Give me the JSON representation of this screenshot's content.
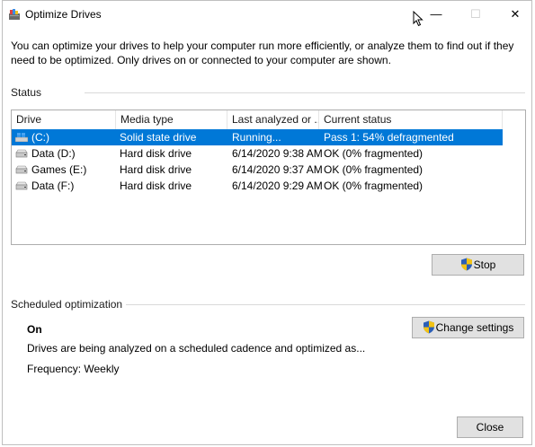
{
  "window": {
    "title": "Optimize Drives",
    "controls": {
      "minimize": "—",
      "maximize": "☐",
      "close": "✕"
    }
  },
  "description": "You can optimize your drives to help your computer run more efficiently, or analyze them to find out if they need to be optimized. Only drives on or connected to your computer are shown.",
  "status": {
    "label": "Status",
    "columns": [
      "Drive",
      "Media type",
      "Last analyzed or ...",
      "Current status"
    ],
    "rows": [
      {
        "drive": "(C:)",
        "media": "Solid state drive",
        "analyzed": "Running...",
        "status": "Pass 1: 54% defragmented",
        "selected": true,
        "icon": "windows-drive-icon"
      },
      {
        "drive": "Data (D:)",
        "media": "Hard disk drive",
        "analyzed": "6/14/2020 9:38 AM",
        "status": "OK (0% fragmented)",
        "selected": false,
        "icon": "hard-drive-icon"
      },
      {
        "drive": "Games (E:)",
        "media": "Hard disk drive",
        "analyzed": "6/14/2020 9:37 AM",
        "status": "OK (0% fragmented)",
        "selected": false,
        "icon": "hard-drive-icon"
      },
      {
        "drive": "Data (F:)",
        "media": "Hard disk drive",
        "analyzed": "6/14/2020 9:29 AM",
        "status": "OK (0% fragmented)",
        "selected": false,
        "icon": "hard-drive-icon"
      }
    ],
    "stop_label": "Stop"
  },
  "scheduled": {
    "label": "Scheduled optimization",
    "state": "On",
    "description": "Drives are being analyzed on a scheduled cadence and optimized as...",
    "frequency": "Frequency: Weekly",
    "change_label": "Change settings"
  },
  "footer": {
    "close_label": "Close"
  },
  "colors": {
    "selection": "#0078d7",
    "button_bg": "#e1e1e1",
    "button_border": "#adadad"
  },
  "icons": [
    "app-defrag-icon",
    "windows-drive-icon",
    "hard-drive-icon",
    "uac-shield-icon"
  ]
}
